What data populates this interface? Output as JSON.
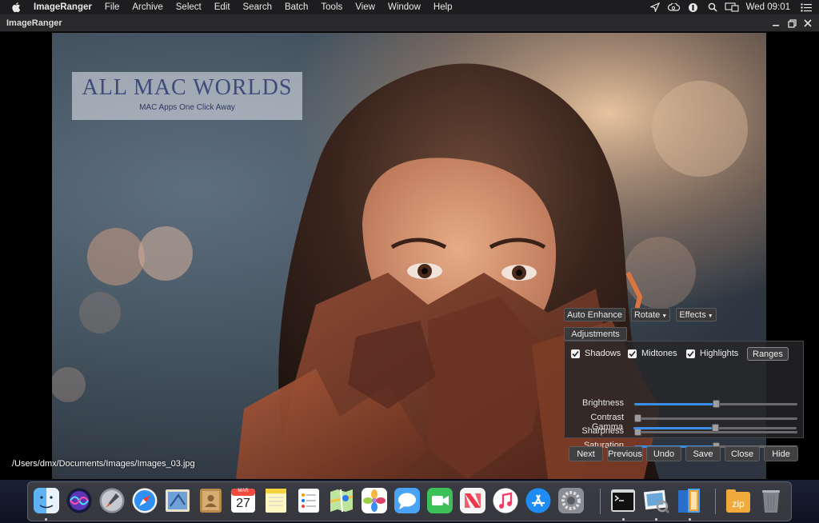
{
  "menubar": {
    "app_name": "ImageRanger",
    "menus": [
      "File",
      "Archive",
      "Select",
      "Edit",
      "Search",
      "Batch",
      "Tools",
      "View",
      "Window",
      "Help"
    ],
    "clock": "Wed 09:01",
    "status_icons": [
      "location-arrow-icon",
      "creative-cloud-icon",
      "shortcuts-icon",
      "search-icon",
      "display-icon",
      "menu-list-icon"
    ]
  },
  "window": {
    "title": "ImageRanger"
  },
  "watermark": {
    "title": "ALL MAC WORLDS",
    "subtitle": "MAC Apps One Click Away"
  },
  "viewer": {
    "file_path": "/Users/dmx/Documents/Images/Images_03.jpg"
  },
  "toolbar": {
    "auto_enhance": "Auto Enhance",
    "rotate": "Rotate",
    "effects": "Effects",
    "adjustments": "Adjustments"
  },
  "adjustments": {
    "checks": [
      {
        "label": "Shadows",
        "checked": true
      },
      {
        "label": "Midtones",
        "checked": true
      },
      {
        "label": "Highlights",
        "checked": true
      }
    ],
    "ranges": "Ranges",
    "sliders": [
      {
        "label": "Brightness",
        "value": 0.5
      },
      {
        "label": "Contrast",
        "value": 0.02
      },
      {
        "label": "Sharpness",
        "value": 0.02
      },
      {
        "label": "Saturation",
        "value": 0.5
      },
      {
        "label": "Gamma",
        "value": 0.5
      }
    ]
  },
  "actions": [
    "Next",
    "Previous",
    "Undo",
    "Save",
    "Close",
    "Hide"
  ],
  "dock": {
    "calendar_month": "MAR",
    "calendar_day": "27",
    "zip_label": "zip",
    "icons": [
      "finder-icon",
      "siri-icon",
      "launchpad-icon",
      "safari-icon",
      "mail-icon",
      "contacts-icon",
      "calendar-icon",
      "notes-icon",
      "reminders-icon",
      "maps-icon",
      "photos-icon",
      "messages-icon",
      "facetime-icon",
      "news-icon",
      "music-icon",
      "app-store-icon",
      "system-preferences-icon",
      "terminal-icon",
      "preview-icon",
      "books-icon",
      "archive-zip-icon",
      "trash-icon"
    ]
  }
}
